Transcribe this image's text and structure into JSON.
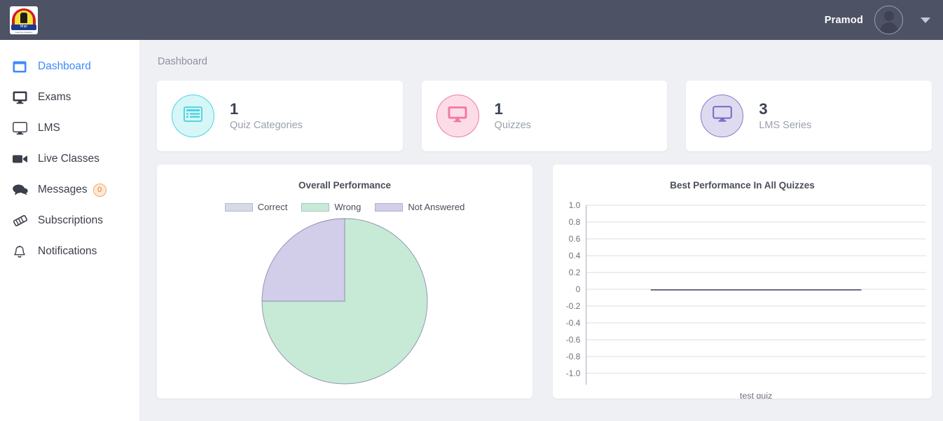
{
  "topbar": {
    "logo_name": "logo",
    "logo_band_text": "शिक्षा",
    "logo_sub_text": "Learning Academy",
    "username": "Pramod",
    "avatar_name": "user-avatar",
    "caret_name": "chevron-down-icon"
  },
  "sidebar": {
    "items": [
      {
        "label": "Dashboard",
        "icon": "dashboard-icon",
        "active": true
      },
      {
        "label": "Exams",
        "icon": "monitor-filled-icon",
        "active": false
      },
      {
        "label": "LMS",
        "icon": "monitor-outline-icon",
        "active": false
      },
      {
        "label": "Live Classes",
        "icon": "video-camera-icon",
        "active": false
      },
      {
        "label": "Messages",
        "icon": "chat-bubbles-icon",
        "active": false,
        "badge": "0"
      },
      {
        "label": "Subscriptions",
        "icon": "ticket-icon",
        "active": false
      },
      {
        "label": "Notifications",
        "icon": "bell-icon",
        "active": false
      }
    ]
  },
  "main": {
    "breadcrumb": "Dashboard",
    "stat_cards": [
      {
        "value": "1",
        "label": "Quiz Categories",
        "icon": "list-card-icon",
        "circle_bg": "#d6f6f8",
        "circle_border": "#4fd3e0",
        "icon_color": "#4fd3e0"
      },
      {
        "value": "1",
        "label": "Quizzes",
        "icon": "desktop-filled-icon",
        "circle_bg": "#fcdde7",
        "circle_border": "#f4789f",
        "icon_color": "#f4789f"
      },
      {
        "value": "3",
        "label": "LMS Series",
        "icon": "desktop-outline-icon",
        "circle_bg": "#dedbf0",
        "circle_border": "#8878cc",
        "icon_color": "#7a68c4"
      }
    ]
  },
  "chart_data": [
    {
      "type": "pie",
      "title": "Overall Performance",
      "legend_position": "top",
      "labels": [
        "Correct",
        "Wrong",
        "Not Answered"
      ],
      "values": [
        0,
        75,
        25
      ],
      "colors": [
        "#d7dae6",
        "#c7ead6",
        "#d2cde8"
      ],
      "slice_border": "#8a8fae"
    },
    {
      "type": "bar",
      "title": "Best Performance In All Quizzes",
      "categories": [
        "test quiz"
      ],
      "values": [
        0
      ],
      "ylim": [
        -1.0,
        1.0
      ],
      "yticks": [
        "1.0",
        "0.8",
        "0.6",
        "0.4",
        "0.2",
        "0",
        "-0.2",
        "-0.4",
        "-0.6",
        "-0.8",
        "-1.0"
      ],
      "ytick_values": [
        1.0,
        0.8,
        0.6,
        0.4,
        0.2,
        0,
        -0.2,
        -0.4,
        -0.6,
        -0.8,
        -1.0
      ],
      "xlabel": "",
      "ylabel": "",
      "grid": true,
      "bar_color": "#4a5068",
      "grid_color": "#dcdde2",
      "tick_color": "#6d707c"
    }
  ]
}
